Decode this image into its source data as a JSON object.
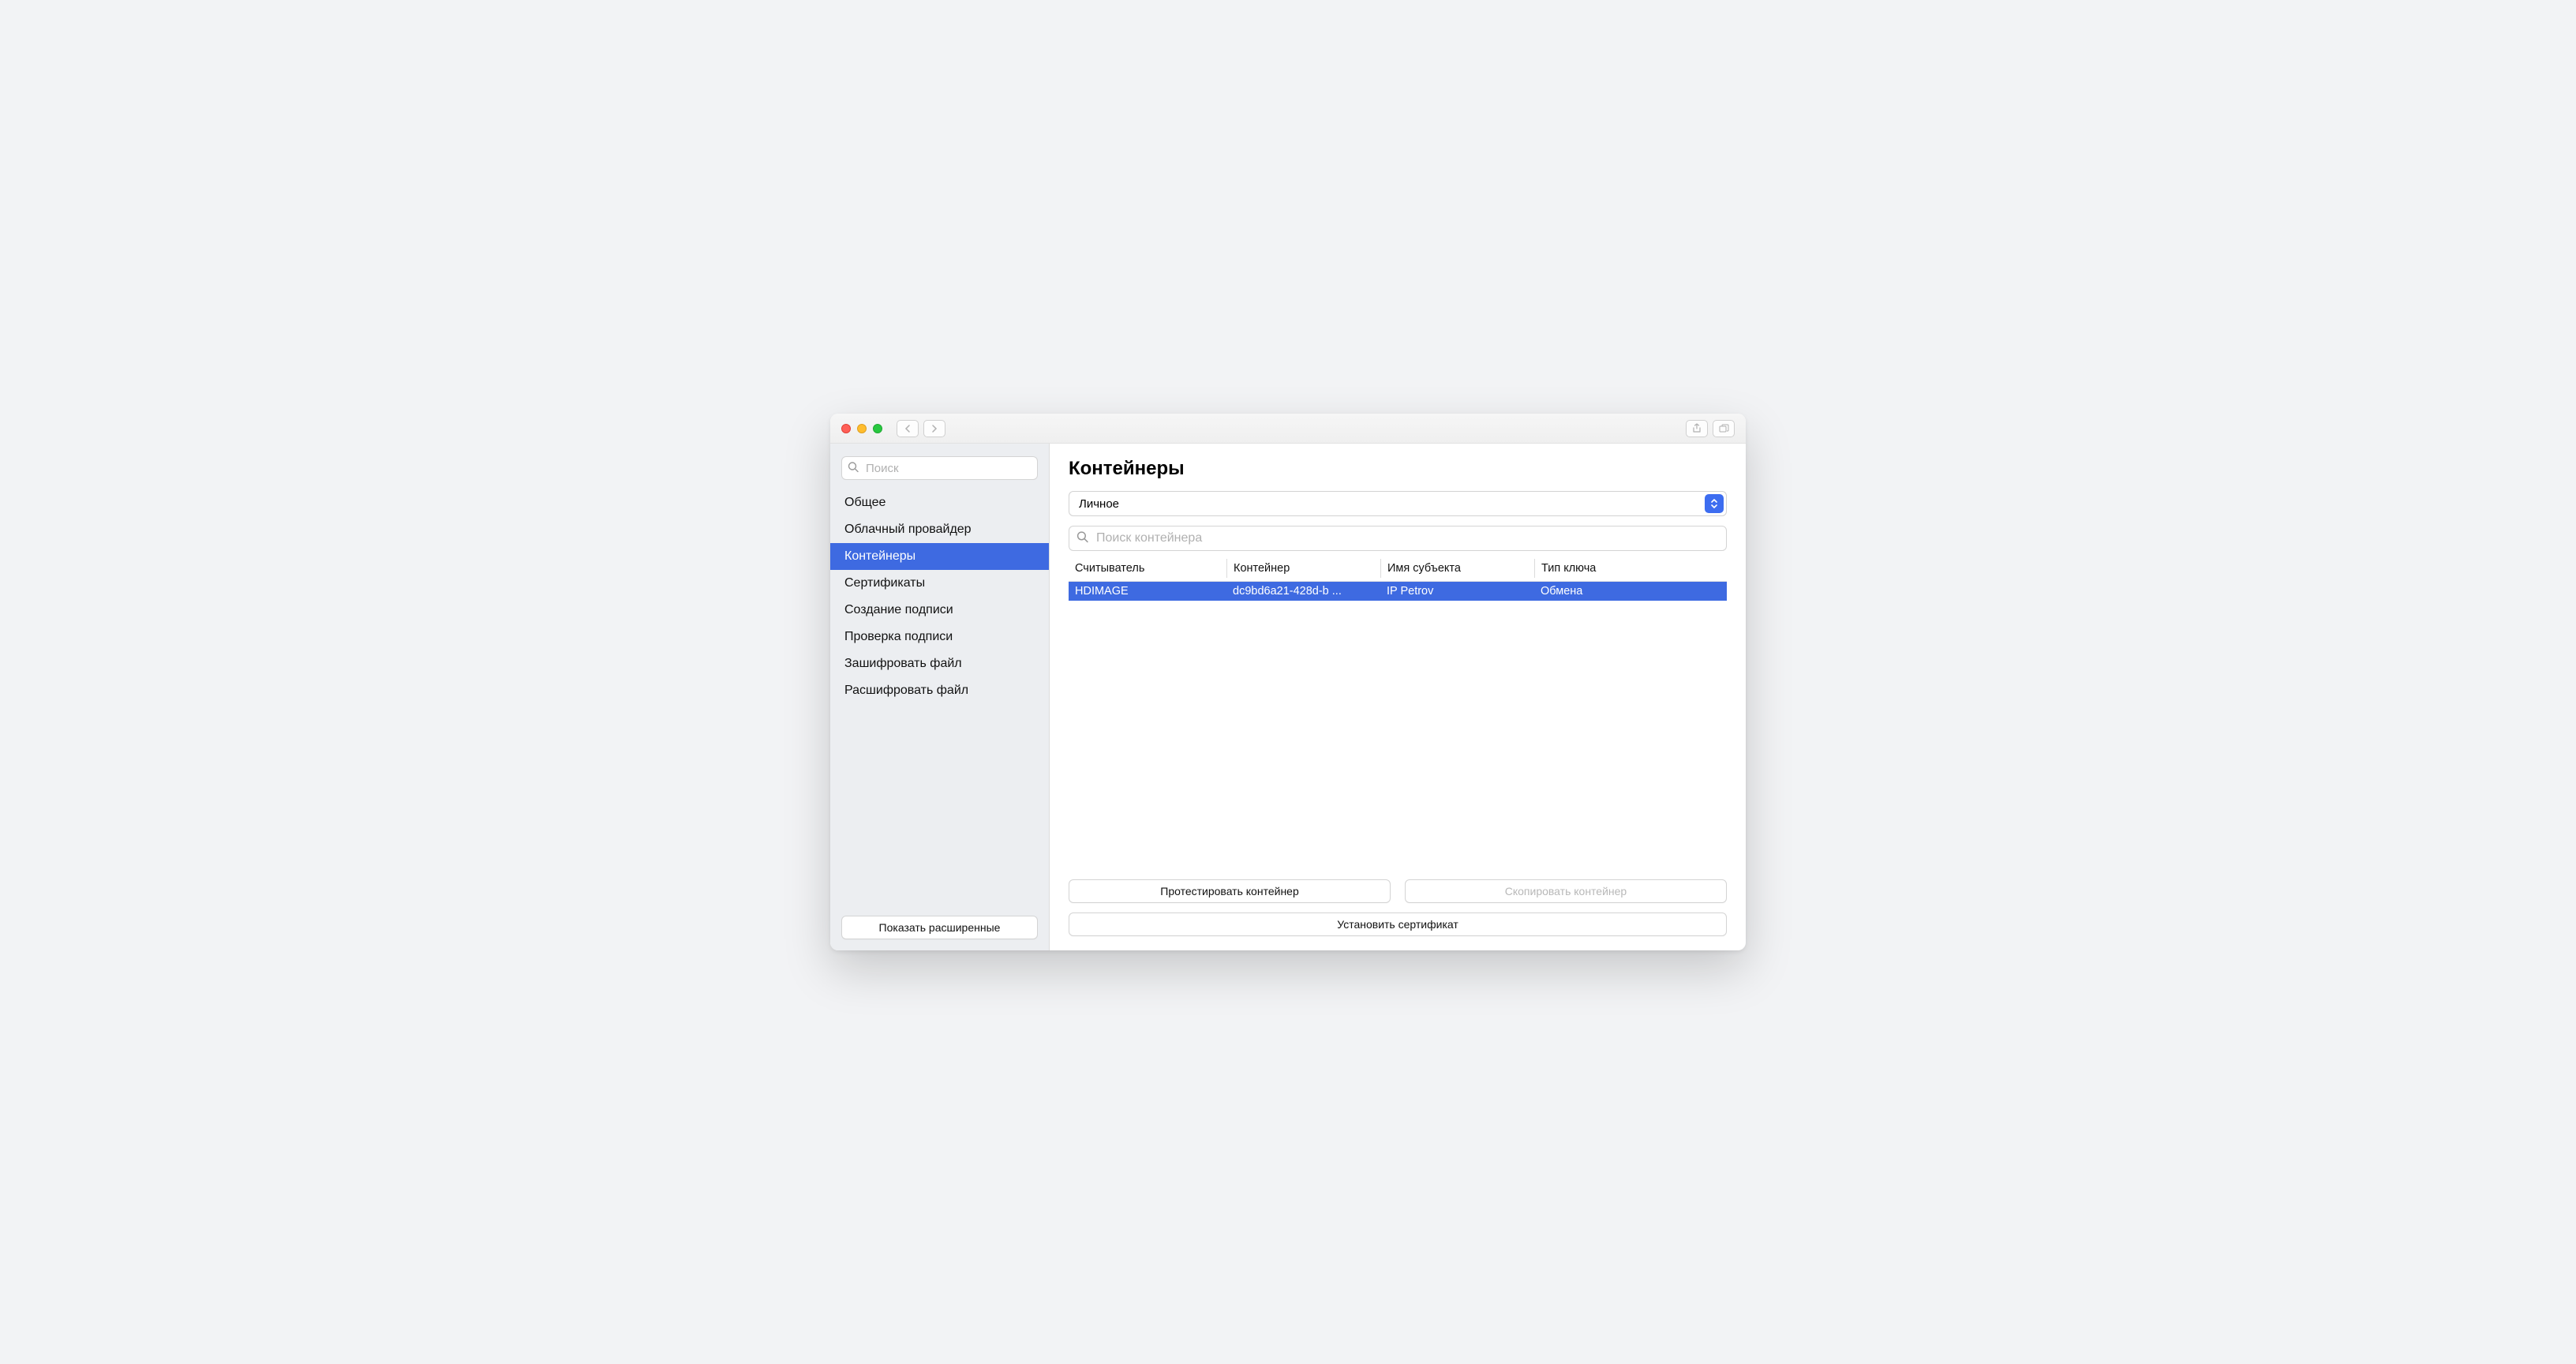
{
  "sidebar": {
    "search_placeholder": "Поиск",
    "items": [
      {
        "label": "Общее",
        "active": false
      },
      {
        "label": "Облачный провайдер",
        "active": false
      },
      {
        "label": "Контейнеры",
        "active": true
      },
      {
        "label": "Сертификаты",
        "active": false
      },
      {
        "label": "Создание подписи",
        "active": false
      },
      {
        "label": "Проверка подписи",
        "active": false
      },
      {
        "label": "Зашифровать файл",
        "active": false
      },
      {
        "label": "Расшифровать файл",
        "active": false
      }
    ],
    "footer_button": "Показать расширенные"
  },
  "main": {
    "title": "Контейнеры",
    "selector_value": "Личное",
    "search_placeholder": "Поиск контейнера",
    "table": {
      "headers": [
        "Считыватель",
        "Контейнер",
        "Имя субъекта",
        "Тип ключа"
      ],
      "rows": [
        {
          "reader": "HDIMAGE",
          "container": "dc9bd6a21-428d-b ...",
          "subject": "IP Petrov",
          "keytype": "Обмена",
          "selected": true
        }
      ]
    },
    "buttons": {
      "test": "Протестировать контейнер",
      "copy": "Скопировать контейнер",
      "install": "Установить сертификат"
    }
  }
}
